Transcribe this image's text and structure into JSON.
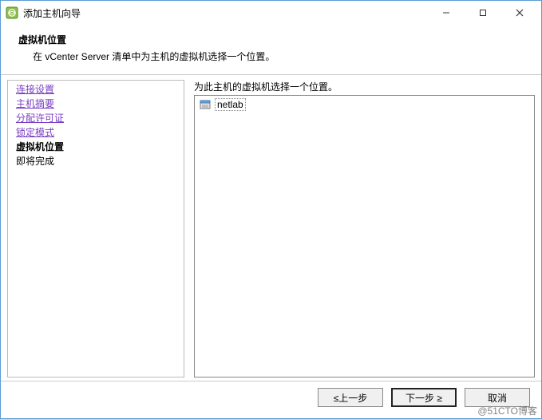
{
  "window": {
    "title": "添加主机向导"
  },
  "header": {
    "title": "虚拟机位置",
    "description": "在 vCenter Server 清单中为主机的虚拟机选择一个位置。"
  },
  "sidebar": {
    "items": [
      {
        "label": "连接设置",
        "type": "link"
      },
      {
        "label": "主机摘要",
        "type": "link"
      },
      {
        "label": "分配许可证",
        "type": "link"
      },
      {
        "label": "锁定模式",
        "type": "link"
      },
      {
        "label": "虚拟机位置",
        "type": "current"
      },
      {
        "label": "即将完成",
        "type": "plain"
      }
    ]
  },
  "content": {
    "label": "为此主机的虚拟机选择一个位置。",
    "tree": {
      "root": {
        "label": "netlab",
        "icon": "datacenter-icon",
        "selected": true
      }
    }
  },
  "buttons": {
    "back": "≤上一步",
    "next": "下一步 ≥",
    "cancel": "取消"
  },
  "watermark": "@51CTO博客"
}
